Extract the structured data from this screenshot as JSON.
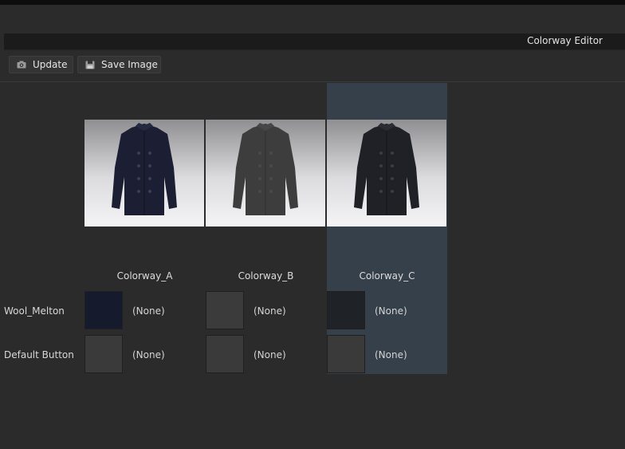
{
  "header": {
    "title": "Colorway Editor"
  },
  "toolbar": {
    "update_label": "Update",
    "save_image_label": "Save Image"
  },
  "colorways": [
    {
      "name": "Colorway_A",
      "jacket_color": "#1c1f33",
      "selected": false
    },
    {
      "name": "Colorway_B",
      "jacket_color": "#3d3d3d",
      "selected": false
    },
    {
      "name": "Colorway_C",
      "jacket_color": "#1f2126",
      "selected": true
    }
  ],
  "rows": [
    {
      "label": "Wool_Melton",
      "cells": [
        {
          "swatch_color": "#151a2c",
          "value": "(None)"
        },
        {
          "swatch_color": "#3b3b3b",
          "value": "(None)"
        },
        {
          "swatch_color": "#1f2226",
          "value": "(None)"
        }
      ]
    },
    {
      "label": "Default Button",
      "cells": [
        {
          "swatch_color": "#3a3a3a",
          "value": "(None)"
        },
        {
          "swatch_color": "#3a3a3a",
          "value": "(None)"
        },
        {
          "swatch_color": "#3a3a3a",
          "value": "(None)"
        }
      ]
    }
  ],
  "colors": {
    "background": "#2b2b2c",
    "selected_column": "#35404a"
  }
}
